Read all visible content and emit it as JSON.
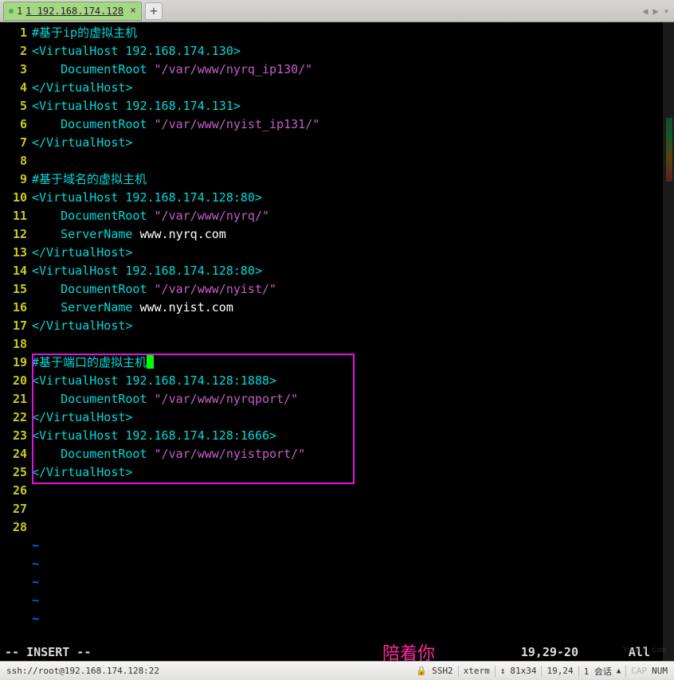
{
  "tab": {
    "title": "1 192.168.174.128",
    "index": "1"
  },
  "lines": [
    {
      "n": "1",
      "segs": [
        {
          "c": "comment",
          "t": "#基于ip的虚拟主机"
        }
      ]
    },
    {
      "n": "2",
      "segs": [
        {
          "c": "tag",
          "t": "<VirtualHost 192.168.174.130>"
        }
      ]
    },
    {
      "n": "3",
      "segs": [
        {
          "c": "plain",
          "t": "    "
        },
        {
          "c": "key",
          "t": "DocumentRoot"
        },
        {
          "c": "plain",
          "t": " "
        },
        {
          "c": "str",
          "t": "\"/var/www/nyrq_ip130/\""
        }
      ]
    },
    {
      "n": "4",
      "segs": [
        {
          "c": "tag",
          "t": "</VirtualHost>"
        }
      ]
    },
    {
      "n": "5",
      "segs": [
        {
          "c": "tag",
          "t": "<VirtualHost 192.168.174.131>"
        }
      ]
    },
    {
      "n": "6",
      "segs": [
        {
          "c": "plain",
          "t": "    "
        },
        {
          "c": "key",
          "t": "DocumentRoot"
        },
        {
          "c": "plain",
          "t": " "
        },
        {
          "c": "str",
          "t": "\"/var/www/nyist_ip131/\""
        }
      ]
    },
    {
      "n": "7",
      "segs": [
        {
          "c": "tag",
          "t": "</VirtualHost>"
        }
      ]
    },
    {
      "n": "8",
      "segs": []
    },
    {
      "n": "9",
      "segs": [
        {
          "c": "comment",
          "t": "#基于域名的虚拟主机"
        }
      ]
    },
    {
      "n": "10",
      "segs": [
        {
          "c": "tag",
          "t": "<VirtualHost 192.168.174.128:80>"
        }
      ]
    },
    {
      "n": "11",
      "segs": [
        {
          "c": "plain",
          "t": "    "
        },
        {
          "c": "key",
          "t": "DocumentRoot"
        },
        {
          "c": "plain",
          "t": " "
        },
        {
          "c": "str",
          "t": "\"/var/www/nyrq/\""
        }
      ]
    },
    {
      "n": "12",
      "segs": [
        {
          "c": "plain",
          "t": "    "
        },
        {
          "c": "key",
          "t": "ServerName"
        },
        {
          "c": "plain",
          "t": " www.nyrq.com"
        }
      ]
    },
    {
      "n": "13",
      "segs": [
        {
          "c": "tag",
          "t": "</VirtualHost>"
        }
      ]
    },
    {
      "n": "14",
      "segs": [
        {
          "c": "tag",
          "t": "<VirtualHost 192.168.174.128:80>"
        }
      ]
    },
    {
      "n": "15",
      "segs": [
        {
          "c": "plain",
          "t": "    "
        },
        {
          "c": "key",
          "t": "DocumentRoot"
        },
        {
          "c": "plain",
          "t": " "
        },
        {
          "c": "str",
          "t": "\"/var/www/nyist/\""
        }
      ]
    },
    {
      "n": "16",
      "segs": [
        {
          "c": "plain",
          "t": "    "
        },
        {
          "c": "key",
          "t": "ServerName"
        },
        {
          "c": "plain",
          "t": " www.nyist.com"
        }
      ]
    },
    {
      "n": "17",
      "segs": [
        {
          "c": "tag",
          "t": "</VirtualHost>"
        }
      ]
    },
    {
      "n": "18",
      "segs": []
    },
    {
      "n": "19",
      "segs": [
        {
          "c": "comment",
          "t": "#基于端口的虚拟主机"
        }
      ],
      "cursor": true
    },
    {
      "n": "20",
      "segs": [
        {
          "c": "tag",
          "t": "<VirtualHost 192.168.174.128:1888>"
        }
      ]
    },
    {
      "n": "21",
      "segs": [
        {
          "c": "plain",
          "t": "    "
        },
        {
          "c": "key",
          "t": "DocumentRoot"
        },
        {
          "c": "plain",
          "t": " "
        },
        {
          "c": "str",
          "t": "\"/var/www/nyrqport/\""
        }
      ]
    },
    {
      "n": "22",
      "segs": [
        {
          "c": "tag",
          "t": "</VirtualHost>"
        }
      ]
    },
    {
      "n": "23",
      "segs": [
        {
          "c": "tag",
          "t": "<VirtualHost 192.168.174.128:1666>"
        }
      ]
    },
    {
      "n": "24",
      "segs": [
        {
          "c": "plain",
          "t": "    "
        },
        {
          "c": "key",
          "t": "DocumentRoot"
        },
        {
          "c": "plain",
          "t": " "
        },
        {
          "c": "str",
          "t": "\"/var/www/nyistport/\""
        }
      ]
    },
    {
      "n": "25",
      "segs": [
        {
          "c": "tag",
          "t": "</VirtualHost>"
        }
      ]
    },
    {
      "n": "26",
      "segs": []
    },
    {
      "n": "27",
      "segs": []
    },
    {
      "n": "28",
      "segs": []
    }
  ],
  "tildes": 5,
  "vim": {
    "mode": "-- INSERT --",
    "watermark": "陪着你",
    "position": "19,29-20",
    "scroll": "All",
    "watermark2": "Yuucn.com"
  },
  "status": {
    "conn": "ssh://root@192.168.174.128:22",
    "proto": "SSH2",
    "term": "xterm",
    "size": "81x34",
    "cursor": "19,24",
    "session": "1 会话",
    "caps": "CAP",
    "num": "NUM"
  }
}
